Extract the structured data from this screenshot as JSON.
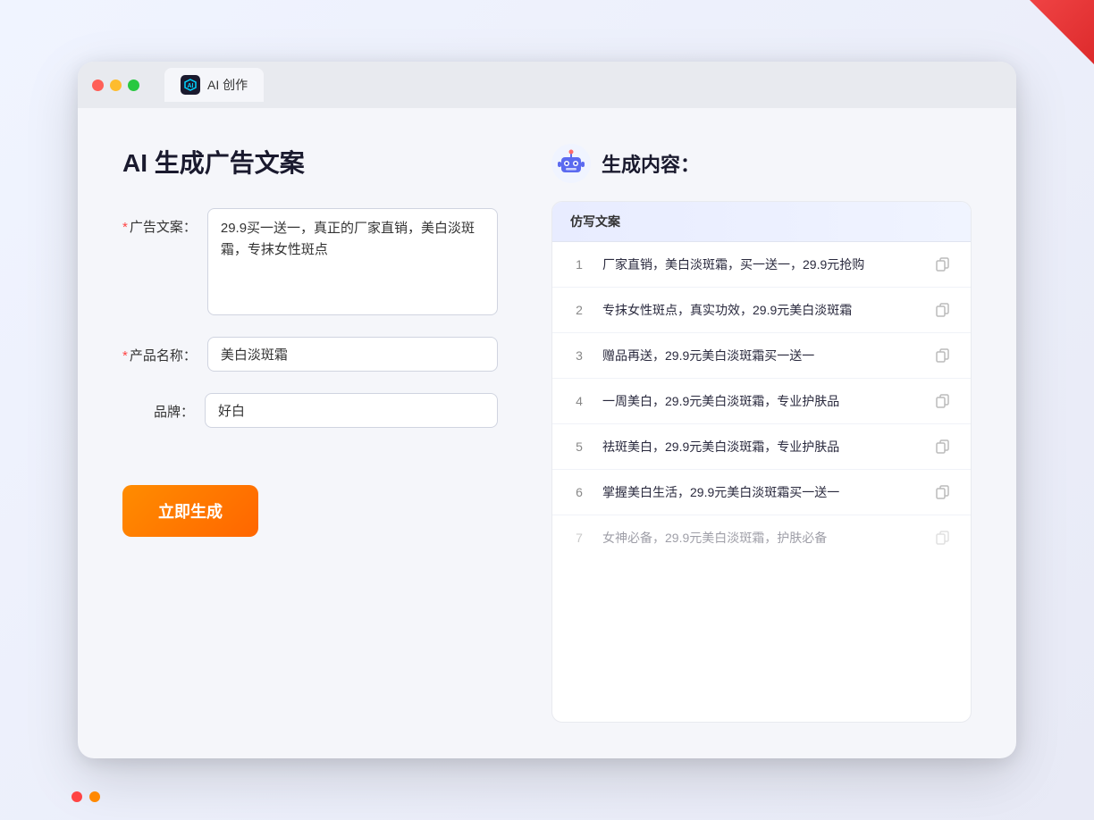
{
  "window": {
    "tab_icon": "AI",
    "tab_label": "AI 创作"
  },
  "left_panel": {
    "page_title": "AI 生成广告文案",
    "form": {
      "ad_copy_label": "广告文案：",
      "ad_copy_required": "*",
      "ad_copy_value": "29.9买一送一，真正的厂家直销，美白淡斑霜，专抹女性斑点",
      "product_name_label": "产品名称：",
      "product_name_required": "*",
      "product_name_value": "美白淡斑霜",
      "brand_label": "品牌：",
      "brand_value": "好白"
    },
    "generate_button": "立即生成"
  },
  "right_panel": {
    "title": "生成内容：",
    "results_header": "仿写文案",
    "results": [
      {
        "num": "1",
        "text": "厂家直销，美白淡斑霜，买一送一，29.9元抢购",
        "dimmed": false
      },
      {
        "num": "2",
        "text": "专抹女性斑点，真实功效，29.9元美白淡斑霜",
        "dimmed": false
      },
      {
        "num": "3",
        "text": "赠品再送，29.9元美白淡斑霜买一送一",
        "dimmed": false
      },
      {
        "num": "4",
        "text": "一周美白，29.9元美白淡斑霜，专业护肤品",
        "dimmed": false
      },
      {
        "num": "5",
        "text": "祛斑美白，29.9元美白淡斑霜，专业护肤品",
        "dimmed": false
      },
      {
        "num": "6",
        "text": "掌握美白生活，29.9元美白淡斑霜买一送一",
        "dimmed": false
      },
      {
        "num": "7",
        "text": "女神必备，29.9元美白淡斑霜，护肤必备",
        "dimmed": true
      }
    ]
  },
  "colors": {
    "required_star": "#ff4444",
    "generate_btn": "#ff6600",
    "accent": "#5b6af0"
  }
}
